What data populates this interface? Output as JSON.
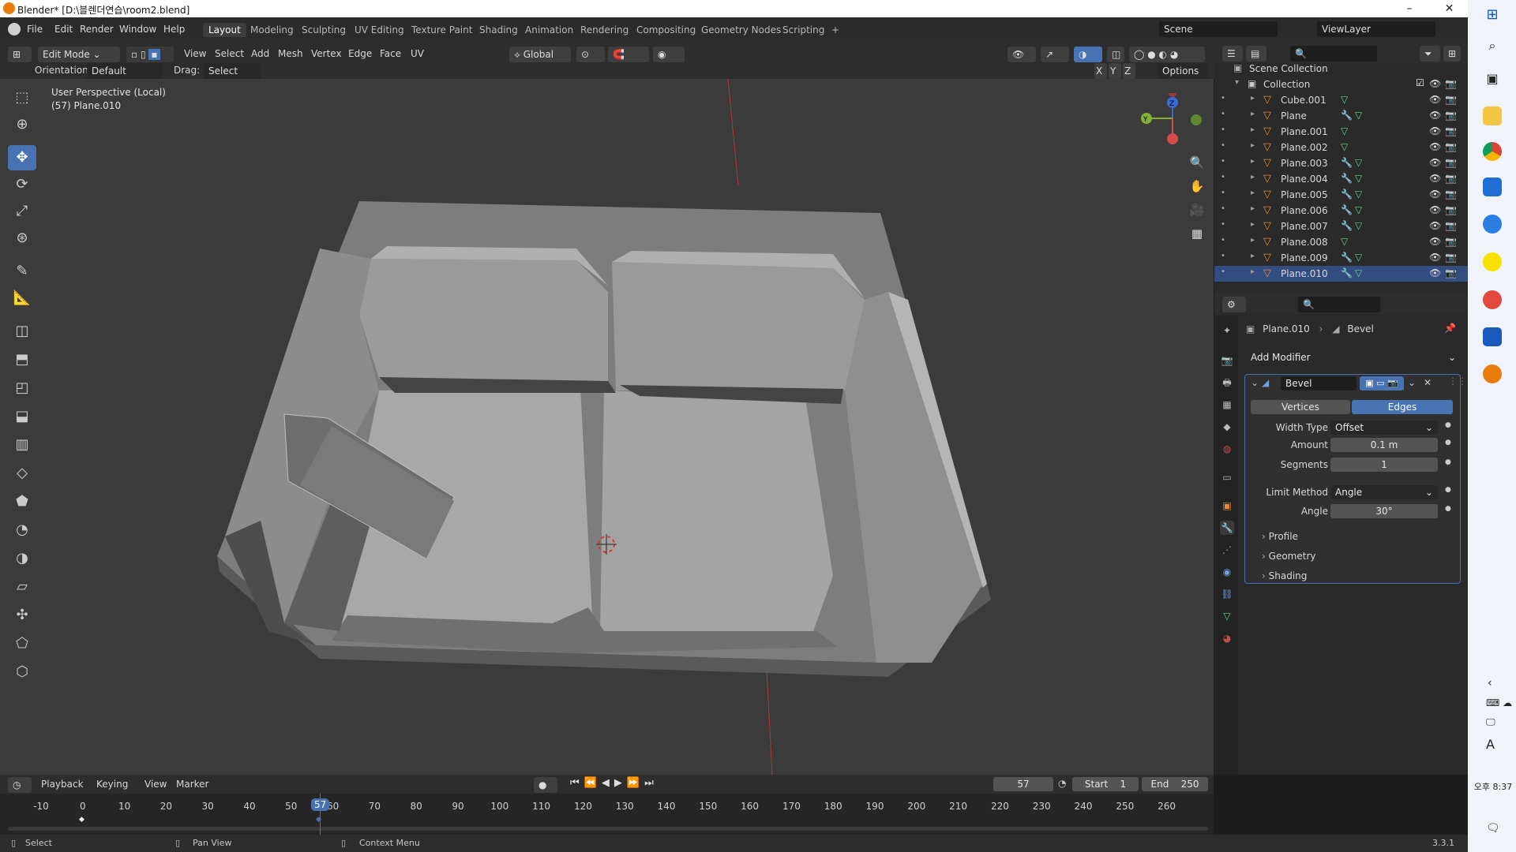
{
  "window": {
    "title": "Blender* [D:\\블렌더연습\\room2.blend]",
    "min": "–",
    "max": "❐",
    "close": "✕"
  },
  "menu": [
    "File",
    "Edit",
    "Render",
    "Window",
    "Help"
  ],
  "workspaces": [
    "Layout",
    "Modeling",
    "Sculpting",
    "UV Editing",
    "Texture Paint",
    "Shading",
    "Animation",
    "Rendering",
    "Compositing",
    "Geometry Nodes",
    "Scripting",
    "+"
  ],
  "active_workspace": "Layout",
  "scene": {
    "label": "Scene",
    "viewlayer": "ViewLayer"
  },
  "header": {
    "mode": "Edit Mode",
    "menus": [
      "View",
      "Select",
      "Add",
      "Mesh",
      "Vertex",
      "Edge",
      "Face",
      "UV"
    ],
    "transform": "Global"
  },
  "header2": {
    "orientation_label": "Orientation:",
    "orientation": "Default",
    "drag_label": "Drag:",
    "drag": "Select Box",
    "axes": [
      "X",
      "Y",
      "Z"
    ],
    "options": "Options"
  },
  "viewport": {
    "line1": "User Perspective (Local)",
    "line2": "(57) Plane.010",
    "axis_x": "X",
    "axis_y": "Y",
    "axis_z": "Z"
  },
  "outliner": {
    "root": "Scene Collection",
    "collection": "Collection",
    "items": [
      {
        "name": "Cube.001",
        "mod": false
      },
      {
        "name": "Plane",
        "mod": true
      },
      {
        "name": "Plane.001",
        "mod": false
      },
      {
        "name": "Plane.002",
        "mod": false
      },
      {
        "name": "Plane.003",
        "mod": true
      },
      {
        "name": "Plane.004",
        "mod": true
      },
      {
        "name": "Plane.005",
        "mod": true
      },
      {
        "name": "Plane.006",
        "mod": true
      },
      {
        "name": "Plane.007",
        "mod": true
      },
      {
        "name": "Plane.008",
        "mod": false
      },
      {
        "name": "Plane.009",
        "mod": true
      },
      {
        "name": "Plane.010",
        "mod": true
      }
    ],
    "selected": "Plane.010"
  },
  "properties": {
    "breadcrumb_obj": "Plane.010",
    "breadcrumb_mod": "Bevel",
    "add_modifier": "Add Modifier",
    "modifier_name": "Bevel",
    "tab_vertices": "Vertices",
    "tab_edges": "Edges",
    "width_type_label": "Width Type",
    "width_type": "Offset",
    "amount_label": "Amount",
    "amount": "0.1 m",
    "segments_label": "Segments",
    "segments": "1",
    "limit_label": "Limit Method",
    "limit": "Angle",
    "angle_label": "Angle",
    "angle": "30°",
    "profile": "Profile",
    "geometry": "Geometry",
    "shading": "Shading"
  },
  "timeline": {
    "menus": [
      "Playback",
      "Keying",
      "View",
      "Marker"
    ],
    "current": "57",
    "start_label": "Start",
    "start": "1",
    "end_label": "End",
    "end": "250",
    "ticks": [
      "-10",
      "0",
      "10",
      "20",
      "30",
      "40",
      "50",
      "60",
      "70",
      "80",
      "90",
      "100",
      "110",
      "120",
      "130",
      "140",
      "150",
      "160",
      "170",
      "180",
      "190",
      "200",
      "210",
      "220",
      "230",
      "240",
      "250",
      "260"
    ],
    "badge": "57"
  },
  "status": {
    "select": "Select",
    "pan": "Pan View",
    "context": "Context Menu",
    "version": "3.3.1"
  },
  "taskbar": {
    "time": "오후 8:37",
    "font_icon": "A"
  },
  "colors": {
    "accent": "#4772b3",
    "orange": "#e87d0d"
  }
}
